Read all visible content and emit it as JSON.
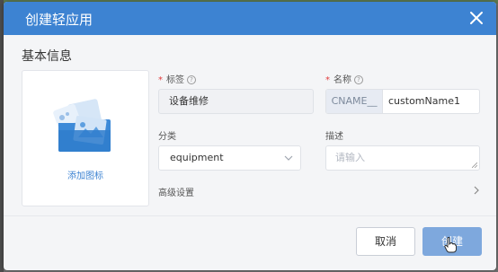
{
  "dialog": {
    "title": "创建轻应用"
  },
  "section": {
    "title": "基本信息"
  },
  "icon_panel": {
    "link_label": "添加图标"
  },
  "fields": {
    "label": {
      "required_mark": "*",
      "label": "标签",
      "value": "设备维修"
    },
    "name": {
      "required_mark": "*",
      "label": "名称",
      "prefix": "CNAME__",
      "value": "customName1"
    },
    "category": {
      "label": "分类",
      "value": "equipment"
    },
    "description": {
      "label": "描述",
      "placeholder": "请输入"
    }
  },
  "advanced": {
    "label": "高级设置"
  },
  "buttons": {
    "cancel": "取消",
    "create": "创建"
  },
  "colors": {
    "header": "#3d83d2",
    "primary_disabled": "#7ea8dd",
    "required": "#e23c3c"
  },
  "icons": [
    "close-icon",
    "help-icon",
    "chevron-down-icon",
    "chevron-right-icon",
    "app-illustration-icon",
    "pointer-cursor-icon"
  ]
}
